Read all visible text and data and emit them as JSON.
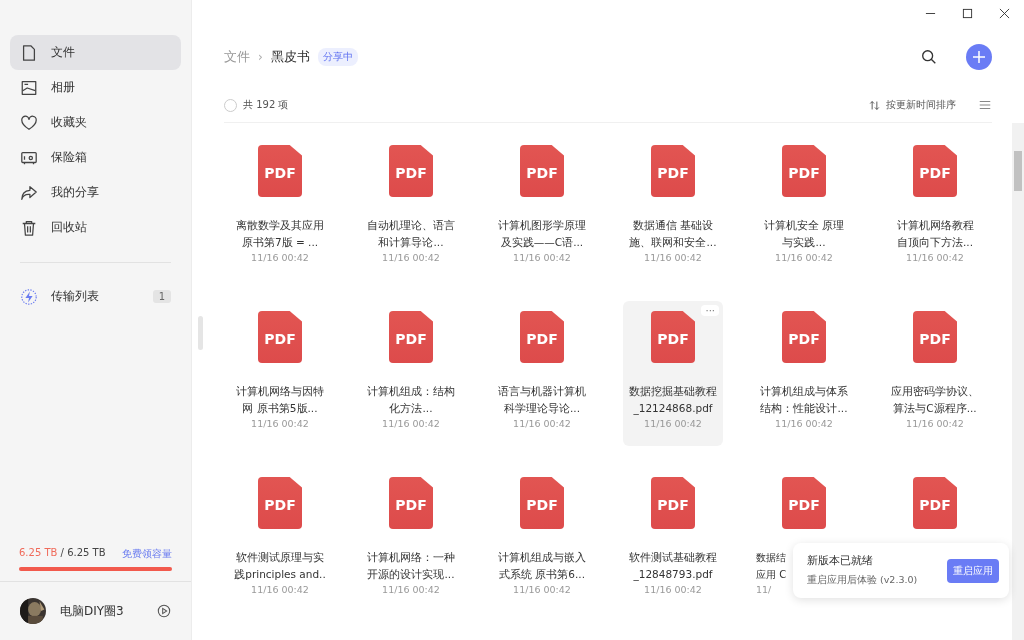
{
  "sidebar": {
    "items": [
      {
        "label": "文件",
        "selected": true
      },
      {
        "label": "相册",
        "selected": false
      },
      {
        "label": "收藏夹",
        "selected": false
      },
      {
        "label": "保险箱",
        "selected": false
      },
      {
        "label": "我的分享",
        "selected": false
      },
      {
        "label": "回收站",
        "selected": false
      }
    ],
    "transfer": {
      "label": "传输列表",
      "badge": "1"
    },
    "storage": {
      "used": "6.25 TB",
      "separator": "/",
      "total": "6.25 TB",
      "link": "免费领容量",
      "level": 1
    },
    "user": {
      "name": "电脑DIY圈3"
    }
  },
  "breadcrumb": {
    "root": "文件",
    "separator": "›",
    "current": "黑皮书",
    "tag": "分享中"
  },
  "toolbar": {
    "checked": false,
    "count": "共 192 项",
    "sort": "按更新时间排序"
  },
  "files": [
    {
      "badge": "PDF",
      "lines": [
        "离散数学及其应用",
        "原书第7版 = ..."
      ],
      "time": "11/16 00:42",
      "selected": false
    },
    {
      "badge": "PDF",
      "lines": [
        "自动机理论、语言",
        "和计算导论..."
      ],
      "time": "11/16 00:42",
      "selected": false
    },
    {
      "badge": "PDF",
      "lines": [
        "计算机图形学原理",
        "及实践——C语..."
      ],
      "time": "11/16 00:42",
      "selected": false
    },
    {
      "badge": "PDF",
      "lines": [
        "数据通信 基础设",
        "施、联网和安全..."
      ],
      "time": "11/16 00:42",
      "selected": false
    },
    {
      "badge": "PDF",
      "lines": [
        "计算机安全 原理",
        "与实践..."
      ],
      "time": "11/16 00:42",
      "selected": false
    },
    {
      "badge": "PDF",
      "lines": [
        "计算机网络教程",
        "自顶向下方法..."
      ],
      "time": "11/16 00:42",
      "selected": false
    },
    {
      "badge": "PDF",
      "lines": [
        "计算机网络与因特",
        "网 原书第5版..."
      ],
      "time": "11/16 00:42",
      "selected": false
    },
    {
      "badge": "PDF",
      "lines": [
        "计算机组成：结构",
        "化方法..."
      ],
      "time": "11/16 00:42",
      "selected": false
    },
    {
      "badge": "PDF",
      "lines": [
        "语言与机器计算机",
        "科学理论导论..."
      ],
      "time": "11/16 00:42",
      "selected": false
    },
    {
      "badge": "PDF",
      "lines": [
        "数据挖掘基础教程",
        "_12124868.pdf"
      ],
      "time": "11/16 00:42",
      "selected": true,
      "more": "···"
    },
    {
      "badge": "PDF",
      "lines": [
        "计算机组成与体系",
        "结构：性能设计..."
      ],
      "time": "11/16 00:42",
      "selected": false
    },
    {
      "badge": "PDF",
      "lines": [
        "应用密码学协议、",
        "算法与C源程序..."
      ],
      "time": "11/16 00:42",
      "selected": false
    },
    {
      "badge": "PDF",
      "lines": [
        "软件测试原理与实",
        "践principles and.."
      ],
      "time": "11/16 00:42",
      "selected": false
    },
    {
      "badge": "PDF",
      "lines": [
        "计算机网络：一种",
        "开源的设计实现..."
      ],
      "time": "11/16 00:42",
      "selected": false
    },
    {
      "badge": "PDF",
      "lines": [
        "计算机组成与嵌入",
        "式系统 原书第6..."
      ],
      "time": "11/16 00:42",
      "selected": false
    },
    {
      "badge": "PDF",
      "lines": [
        "软件测试基础教程",
        "_12848793.pdf"
      ],
      "time": "11/16 00:42",
      "selected": false
    },
    {
      "badge": "PDF",
      "lines": [
        "数据结",
        "应用 C"
      ],
      "time": "11/",
      "selected": false,
      "clipped": true
    },
    {
      "badge": "PDF",
      "selected": false,
      "clipped": true
    }
  ],
  "toast": {
    "title": "新版本已就绪",
    "subtitle": "重启应用后体验",
    "version": "(v2.3.0)",
    "button": "重启应用"
  }
}
